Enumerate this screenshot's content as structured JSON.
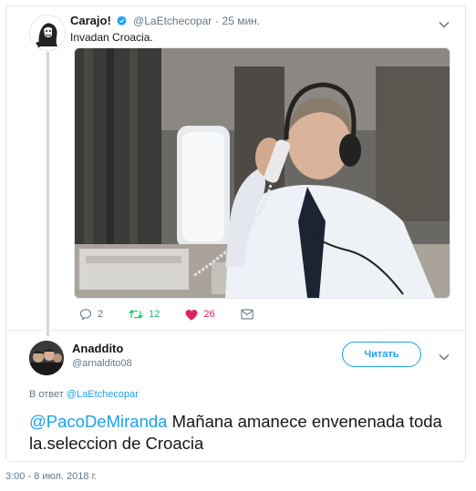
{
  "quoted_tweet": {
    "author_name": "Carajo!",
    "author_handle": "@LaEtchecopar",
    "separator": "·",
    "time": "25 мин.",
    "text": "Invadan Croacia.",
    "stats": {
      "replies": "2",
      "retweets": "12",
      "likes": "26"
    }
  },
  "reply_tweet": {
    "author_name": "Anaddito",
    "author_handle": "@arnaldito08",
    "follow_label": "Читать",
    "reply_prefix": "В ответ",
    "reply_to": "@LaEtchecopar",
    "mention": "@PacoDeMiranda",
    "text": " Mañana amanece envenenada toda la.seleccion de Croacia",
    "timestamp": "3:00 - 8 июл. 2018 г."
  },
  "colors": {
    "accent": "#1da1f2",
    "retweet": "#17bf63",
    "like": "#e0245e",
    "muted": "#657786"
  },
  "icons": [
    "verified-badge-icon",
    "chevron-down-icon",
    "reply-icon",
    "retweet-icon",
    "heart-icon",
    "direct-message-icon"
  ]
}
